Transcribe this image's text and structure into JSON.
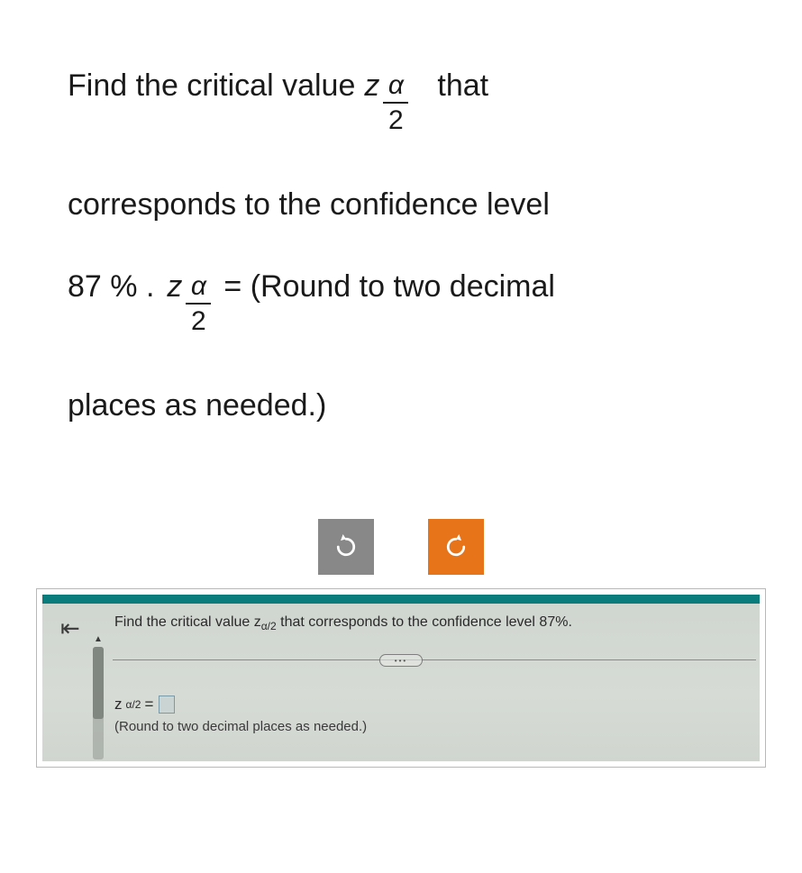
{
  "question": {
    "line1_a": "Find the critical value",
    "z": "z",
    "frac_num": "α",
    "frac_den": "2",
    "line1_b": "that",
    "line2": "corresponds to the confidence level",
    "line3_a": "87 % .",
    "line3_b": "= (Round to two decimal",
    "line4": "places as needed.)"
  },
  "controls": {
    "undo": "undo",
    "redo": "redo"
  },
  "inner": {
    "back": "⇤",
    "prompt_a": "Find the critical value z",
    "prompt_sub": "α/2",
    "prompt_b": " that corresponds to the confidence level 87%.",
    "ellipsis": "•••",
    "answer_label_a": "z",
    "answer_label_sub": "α/2",
    "answer_label_eq": " = ",
    "round_note": "(Round to two decimal places as needed.)"
  },
  "chart_data": {
    "type": "table",
    "title": "Critical value problem",
    "confidence_level_percent": 87,
    "variable": "z_{α/2}",
    "rounding": "two decimal places"
  }
}
